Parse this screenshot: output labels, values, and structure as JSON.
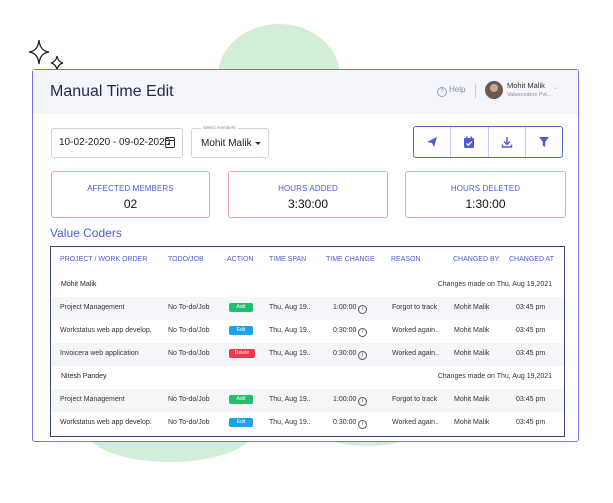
{
  "header": {
    "title": "Manual Time Edit",
    "help_label": "Help",
    "user_name": "Mohit Malik",
    "user_company": "Valuecoders Pvt..."
  },
  "filters": {
    "date_range": "10-02-2020 - 09-02-2020",
    "members_legend": "Select members",
    "member_selected": "Mohit Malik"
  },
  "toolbar": [
    "send-icon",
    "calendar-check-icon",
    "download-icon",
    "filter-icon"
  ],
  "stats": [
    {
      "label": "AFFECTED MEMBERS",
      "value": "02",
      "color": "#4f5bd5"
    },
    {
      "label": "HOURS ADDED",
      "value": "3:30:00",
      "color": "#4f5bd5"
    },
    {
      "label": "HOURS DELETED",
      "value": "1:30:00",
      "color": "#4f5bd5"
    }
  ],
  "company": "Value Coders",
  "table": {
    "columns": [
      "PROJECT / WORK ORDER",
      "TODO/JOB",
      "ACTION",
      "TIME SPAN",
      "TIME CHANGE",
      "REASON",
      "CHANGED BY",
      "CHANGED AT"
    ],
    "groups": [
      {
        "member": "Mohit Malik",
        "note": "Changes made on Thu, Aug 19,2021",
        "rows": [
          {
            "project": "Project Management",
            "todo": "No To-do/Job",
            "action": "Add",
            "action_color": "#1fc06b",
            "span": "Thu, Aug 19..",
            "change": "1:00:00",
            "reason": "Forgot to track",
            "by": "Mohit Malik",
            "at": "03:45 pm"
          },
          {
            "project": "Workstatus web app develop.",
            "todo": "No To-do/Job",
            "action": "Edit",
            "action_color": "#1aa3e8",
            "span": "Thu, Aug 19..",
            "change": "0:30:00",
            "reason": "Worked again..",
            "by": "Mohit Malik",
            "at": "03:45 pm"
          },
          {
            "project": "Invoicera web application",
            "todo": "No To-do/Job",
            "action": "Delete",
            "action_color": "#ec3a4a",
            "span": "Thu, Aug 19..",
            "change": "0:30:00",
            "reason": "Worked again..",
            "by": "Mohit Malik",
            "at": "03:45 pm"
          }
        ]
      },
      {
        "member": "Nitesh Pandey",
        "note": "Changes made on Thu, Aug 19,2021",
        "rows": [
          {
            "project": "Project Management",
            "todo": "No To-do/Job",
            "action": "Add",
            "action_color": "#1fc06b",
            "span": "Thu, Aug 19..",
            "change": "1:00:00",
            "reason": "Forgot to track",
            "by": "Mohit Malik",
            "at": "03:45 pm"
          },
          {
            "project": "Workstatus web app develop.",
            "todo": "No To-do/Job",
            "action": "Edit",
            "action_color": "#1aa3e8",
            "span": "Thu, Aug 19..",
            "change": "0:30:00",
            "reason": "Worked again..",
            "by": "Mohit Malik",
            "at": "03:45 pm"
          }
        ]
      }
    ]
  },
  "colors": {
    "accent": "#4f5bd5",
    "card_border": "#7d6ee0",
    "stat_border": "#ec9fbe"
  }
}
